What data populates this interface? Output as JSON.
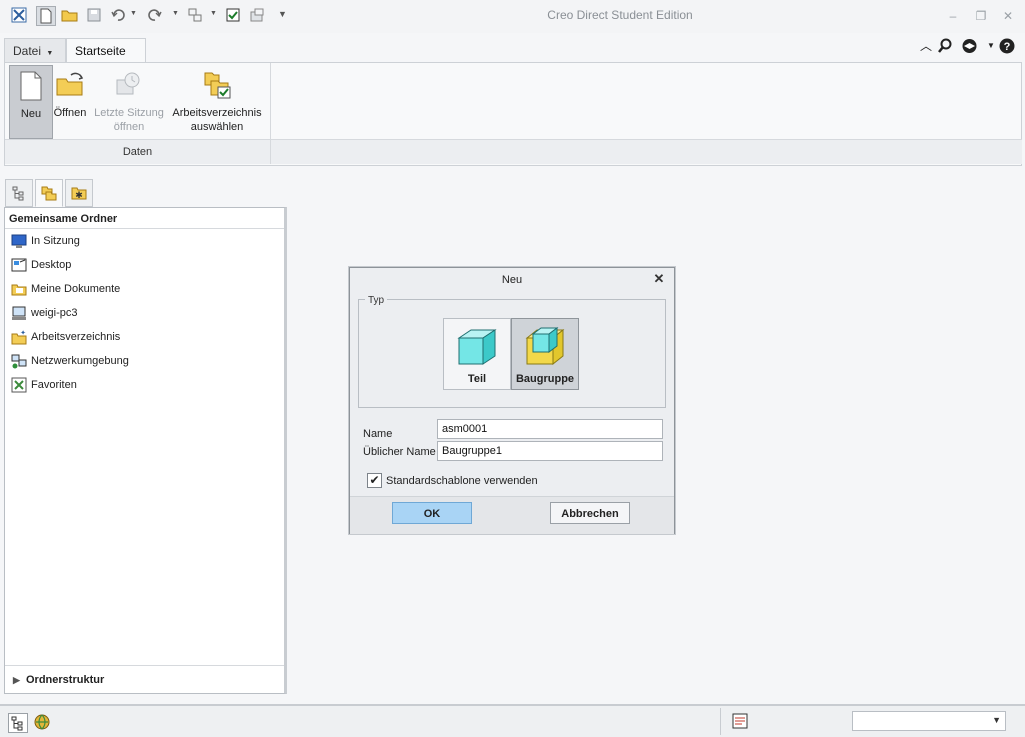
{
  "app": {
    "title": "Creo Direct Student Edition"
  },
  "tabs": {
    "datei": "Datei",
    "startseite": "Startseite"
  },
  "ribbon": {
    "buttons": [
      {
        "label": "Neu"
      },
      {
        "label": "Öffnen"
      },
      {
        "label_line1": "Letzte Sitzung",
        "label_line2": "öffnen"
      },
      {
        "label_line1": "Arbeitsverzeichnis",
        "label_line2": "auswählen"
      }
    ],
    "group_label": "Daten"
  },
  "navigator": {
    "header": "Gemeinsame Ordner",
    "items": [
      {
        "label": "In Sitzung",
        "icon": "in-session-icon"
      },
      {
        "label": "Desktop",
        "icon": "desktop-icon"
      },
      {
        "label": "Meine Dokumente",
        "icon": "folder-icon"
      },
      {
        "label": "weigi-pc3",
        "icon": "computer-icon"
      },
      {
        "label": "Arbeitsverzeichnis",
        "icon": "working-dir-icon"
      },
      {
        "label": "Netzwerkumgebung",
        "icon": "network-icon"
      },
      {
        "label": "Favoriten",
        "icon": "favorites-icon"
      }
    ],
    "footer": "Ordnerstruktur"
  },
  "dialog": {
    "title": "Neu",
    "type_group": "Typ",
    "types": [
      {
        "label": "Teil",
        "selected": false
      },
      {
        "label": "Baugruppe",
        "selected": true
      }
    ],
    "name_label": "Name",
    "name_value": "asm0001",
    "common_name_label": "Üblicher Name",
    "common_name_value": "Baugruppe1",
    "template_checkbox_label": "Standardschablone verwenden",
    "template_checked": true,
    "ok_label": "OK",
    "cancel_label": "Abbrechen"
  },
  "colors": {
    "accent_button": "#a9d4f5",
    "ribbon_bg": "#f8f9fa"
  }
}
